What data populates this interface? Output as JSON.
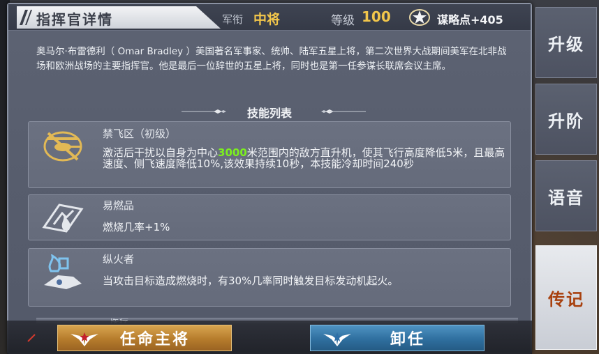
{
  "header": {
    "title": "指挥官详情",
    "rank_label": "军衔",
    "rank_value": "中将",
    "level_label": "等级",
    "level_value": "100",
    "strategy_points": "谋略点+405"
  },
  "bio": "奥马尔·布雷德利（ Omar Bradley ）美国著名军事家、统帅、陆军五星上将，第二次世界大战期间美军在北非战场和欧洲战场的主要指挥官。他是最后一位辞世的五星上将，同时也是第一任参谋长联席会议主席。",
  "skills_section_title": "技能列表",
  "skills": [
    {
      "name": "禁飞区（初级）",
      "desc_before": "激活后干扰以自身为中心",
      "desc_highlight": "3000",
      "desc_after": "米范围内的敌方直升机，使其飞行高度降低5米，且最高速度、侧飞速度降低10%,该效果持续10秒，本技能冷却时间240秒",
      "icon": "helicopter-crossed-icon"
    },
    {
      "name": "易燃品",
      "desc": "燃烧几率+1%",
      "icon": "flammable-icon"
    },
    {
      "name": "纵火者",
      "desc": "当攻击目标造成燃烧时，有30%几率同时触发目标发动机起火。",
      "icon": "arsonist-icon"
    },
    {
      "name": "医疗",
      "icon": "medical-icon"
    }
  ],
  "buttons": {
    "appoint": "任命主将",
    "dismiss": "卸任"
  },
  "side_tabs": [
    {
      "label": "升级",
      "active": false
    },
    {
      "label": "升阶",
      "active": false
    },
    {
      "label": "语音",
      "active": false
    },
    {
      "label": "传记",
      "active": true
    }
  ],
  "colors": {
    "highlight": "#7cf01e",
    "gold": "#f2c64b",
    "active_tab_text": "#a8410f"
  }
}
